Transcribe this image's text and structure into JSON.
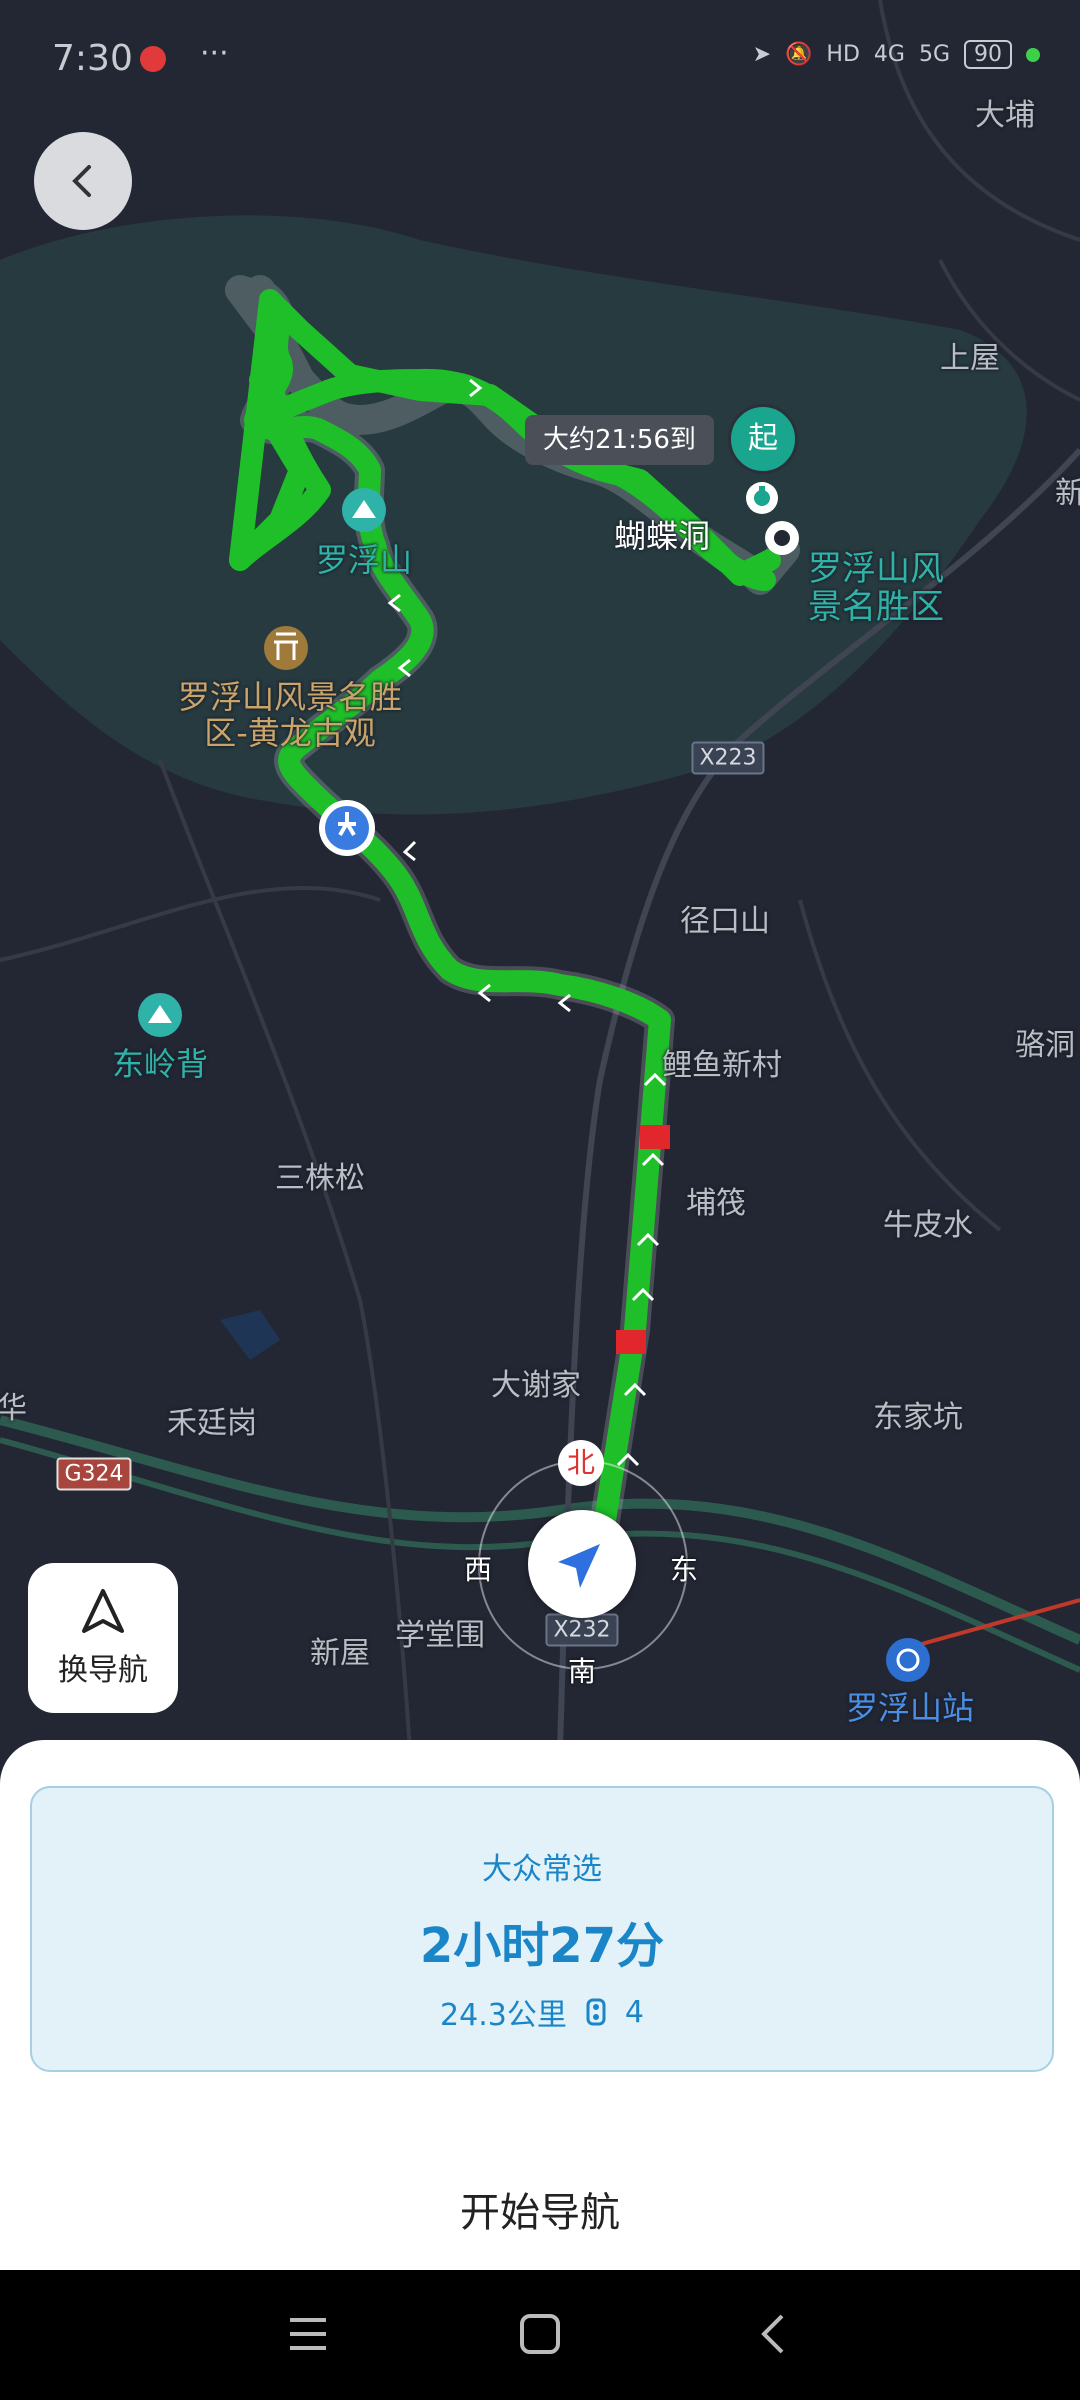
{
  "status_bar": {
    "time": "7:30",
    "overflow": "···",
    "network_hd": "HD",
    "net_4g": "4G",
    "net_5g": "5G",
    "battery": "90"
  },
  "map": {
    "eta_bubble": "大约21:56到",
    "start_marker": "起",
    "labels": {
      "dabu": "大埔",
      "shangwu": "上屋",
      "xin": "新",
      "hudiedong": "蝴蝶洞",
      "luofushan": "罗浮山",
      "scenic_1": "罗浮山风",
      "scenic_2": "景名胜区",
      "huanglong_1": "罗浮山风景名胜",
      "huanglong_2": "区-黄龙古观",
      "jingkoushan": "径口山",
      "dongling": "东岭背",
      "liyu": "鲤鱼新村",
      "luo": "骆洞",
      "sanzhusong": "三株松",
      "bucang": "埔筏",
      "nipishui": "牛皮水",
      "daxiejia": "大谢家",
      "hetinggang": "禾廷岗",
      "dongjiakeng": "东家坑",
      "hua": "华",
      "xinwu": "新屋",
      "xuetangwei": "学堂围",
      "station": "罗浮山站"
    },
    "shields": {
      "x223": "X223",
      "g324": "G324",
      "x232": "X232"
    },
    "compass": {
      "north": "北",
      "east": "东",
      "west": "西",
      "south": "南"
    }
  },
  "controls": {
    "switch_nav_label": "换导航"
  },
  "route": {
    "tag": "大众常选",
    "duration": "2小时27分",
    "distance": "24.3公里",
    "traffic_lights": "4"
  },
  "actions": {
    "start_navigation": "开始导航"
  },
  "colors": {
    "route": "#1fbf2a",
    "congestion": "#e1262c",
    "accent": "#1a86c8"
  }
}
